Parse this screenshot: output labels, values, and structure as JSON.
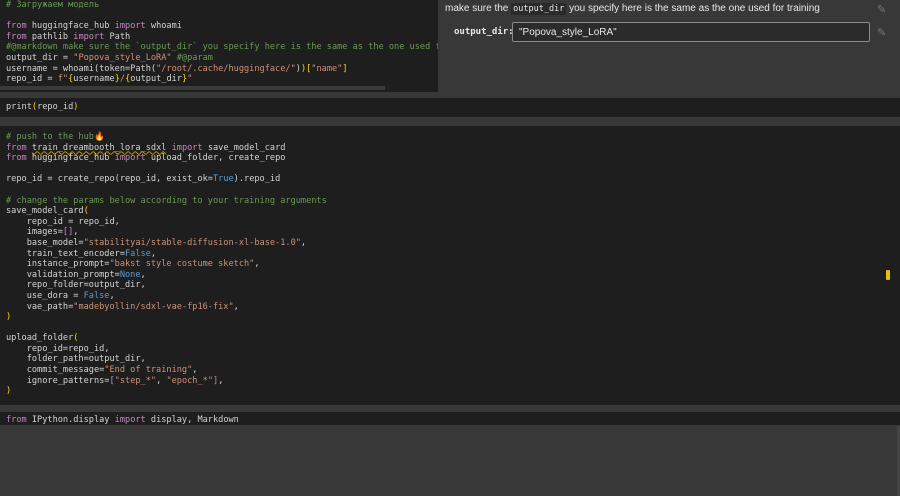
{
  "form": {
    "description_before": "make sure the ",
    "description_code": "output_dir",
    "description_after": " you specify here is the same as the one used for training",
    "field_label": "output_dir:",
    "field_value": "\"Popova_style_LoRA\""
  },
  "cells": [
    {
      "lines": [
        [
          [
            "com",
            "# Загружаем модель"
          ]
        ],
        [],
        [
          [
            "kw",
            "from"
          ],
          [
            "plain",
            " huggingface_hub "
          ],
          [
            "kw",
            "import"
          ],
          [
            "plain",
            " whoami"
          ]
        ],
        [
          [
            "kw",
            "from"
          ],
          [
            "plain",
            " pathlib "
          ],
          [
            "kw",
            "import"
          ],
          [
            "plain",
            " Path"
          ]
        ],
        [
          [
            "com",
            "#@markdown make sure the `output_dir` you specify here is the same as the one used for tra"
          ]
        ],
        [
          [
            "plain",
            "output_dir = "
          ],
          [
            "str",
            "\"Popova_style_LoRA\""
          ],
          [
            "com",
            " #@param"
          ]
        ],
        [
          [
            "plain",
            "username = whoami(token=Path("
          ],
          [
            "str",
            "\"/root/.cache/huggingface/\""
          ],
          [
            "plain",
            ")"
          ],
          [
            "br",
            ")["
          ],
          [
            "str",
            "\"name\""
          ],
          [
            "br",
            "]"
          ]
        ],
        [
          [
            "plain",
            "repo_id = "
          ],
          [
            "str",
            "f\""
          ],
          [
            "br",
            "{"
          ],
          [
            "plain",
            "username"
          ],
          [
            "br",
            "}"
          ],
          [
            "str",
            "/"
          ],
          [
            "br",
            "{"
          ],
          [
            "plain",
            "output_dir"
          ],
          [
            "br",
            "}"
          ],
          [
            "str",
            "\""
          ]
        ]
      ]
    },
    {
      "lines": [
        [
          [
            "plain",
            "print"
          ],
          [
            "br",
            "("
          ],
          [
            "plain",
            "repo_id"
          ],
          [
            "br",
            ")"
          ]
        ]
      ]
    },
    {
      "lines": [
        [
          [
            "com",
            "# push to the hub🔥"
          ]
        ],
        [
          [
            "kw",
            "from"
          ],
          [
            "plain",
            " "
          ],
          [
            "ul",
            "train_dreambooth_lora_sdxl"
          ],
          [
            "plain",
            " "
          ],
          [
            "kw",
            "import"
          ],
          [
            "plain",
            " save_model_card"
          ]
        ],
        [
          [
            "kw",
            "from"
          ],
          [
            "plain",
            " huggingface_hub "
          ],
          [
            "kw",
            "import"
          ],
          [
            "plain",
            " upload_folder, create_repo"
          ]
        ],
        [],
        [
          [
            "plain",
            "repo_id = create_repo(repo_id, exist_ok="
          ],
          [
            "const",
            "True"
          ],
          [
            "plain",
            ").repo_id"
          ]
        ],
        [],
        [
          [
            "com",
            "# change the params below according to your training arguments"
          ]
        ],
        [
          [
            "plain",
            "save_model_card"
          ],
          [
            "br",
            "("
          ]
        ],
        [
          [
            "plain",
            "    repo_id = repo_id,"
          ]
        ],
        [
          [
            "plain",
            "    images="
          ],
          [
            "kw",
            "[]"
          ],
          [
            "plain",
            ","
          ]
        ],
        [
          [
            "plain",
            "    base_model="
          ],
          [
            "str",
            "\"stabilityai/stable-diffusion-xl-base-1.0\""
          ],
          [
            "plain",
            ","
          ]
        ],
        [
          [
            "plain",
            "    train_text_encoder="
          ],
          [
            "const",
            "False"
          ],
          [
            "plain",
            ","
          ]
        ],
        [
          [
            "plain",
            "    instance_prompt="
          ],
          [
            "str",
            "\"bakst style costume sketch\""
          ],
          [
            "plain",
            ","
          ]
        ],
        [
          [
            "plain",
            "    validation_prompt="
          ],
          [
            "const",
            "None"
          ],
          [
            "plain",
            ","
          ]
        ],
        [
          [
            "plain",
            "    repo_folder=output_dir,"
          ]
        ],
        [
          [
            "plain",
            "    use_dora = "
          ],
          [
            "const",
            "False"
          ],
          [
            "plain",
            ","
          ]
        ],
        [
          [
            "plain",
            "    vae_path="
          ],
          [
            "str",
            "\"madebyollin/sdxl-vae-fp16-fix\""
          ],
          [
            "plain",
            ","
          ]
        ],
        [
          [
            "br",
            ")"
          ]
        ],
        [],
        [
          [
            "plain",
            "upload_folder"
          ],
          [
            "br",
            "("
          ]
        ],
        [
          [
            "plain",
            "    repo_id=repo_id,"
          ]
        ],
        [
          [
            "plain",
            "    folder_path=output_dir,"
          ]
        ],
        [
          [
            "plain",
            "    commit_message="
          ],
          [
            "str",
            "\"End of training\""
          ],
          [
            "plain",
            ","
          ]
        ],
        [
          [
            "plain",
            "    ignore_patterns="
          ],
          [
            "kw",
            "["
          ],
          [
            "str",
            "\"step_*\""
          ],
          [
            "plain",
            ", "
          ],
          [
            "str",
            "\"epoch_*\""
          ],
          [
            "kw",
            "]"
          ],
          [
            "plain",
            ","
          ]
        ],
        [
          [
            "br",
            ")"
          ]
        ]
      ]
    },
    {
      "lines": [
        [
          [
            "kw",
            "from"
          ],
          [
            "plain",
            " IPython.display "
          ],
          [
            "kw",
            "import"
          ],
          [
            "plain",
            " display, Markdown"
          ]
        ]
      ]
    }
  ]
}
